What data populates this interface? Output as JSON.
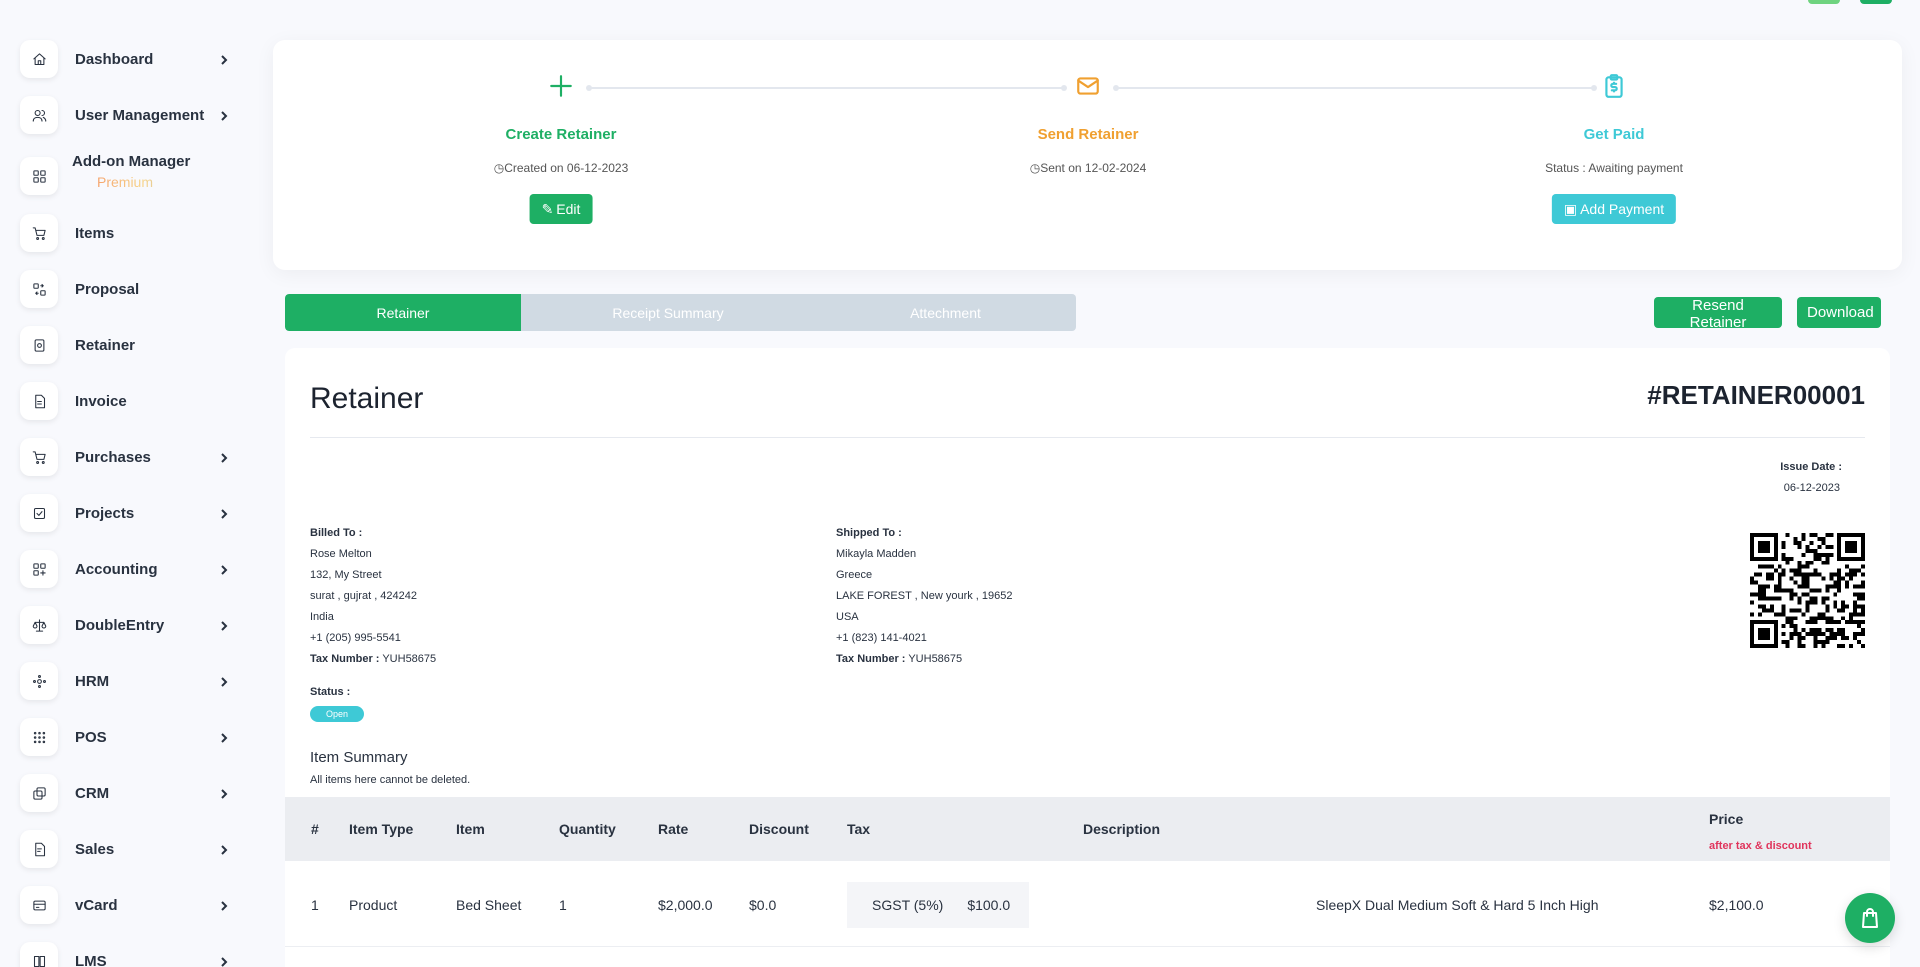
{
  "sidebar": {
    "items": [
      {
        "label": "Dashboard",
        "icon": "home-icon",
        "chevron": true
      },
      {
        "label": "User Management",
        "icon": "users-icon",
        "chevron": true
      },
      {
        "label": "Add-on Manager",
        "icon": "apps-icon",
        "chevron": false,
        "badge": "Premium"
      },
      {
        "label": "Items",
        "icon": "cart-icon",
        "chevron": false
      },
      {
        "label": "Proposal",
        "icon": "exchange-icon",
        "chevron": false
      },
      {
        "label": "Retainer",
        "icon": "retainer-icon",
        "chevron": false
      },
      {
        "label": "Invoice",
        "icon": "invoice-icon",
        "chevron": false
      },
      {
        "label": "Purchases",
        "icon": "purchase-cart-icon",
        "chevron": true
      },
      {
        "label": "Projects",
        "icon": "checkbox-icon",
        "chevron": true
      },
      {
        "label": "Accounting",
        "icon": "grid-plus-icon",
        "chevron": true
      },
      {
        "label": "DoubleEntry",
        "icon": "scale-icon",
        "chevron": true
      },
      {
        "label": "HRM",
        "icon": "hrm-icon",
        "chevron": true
      },
      {
        "label": "POS",
        "icon": "dots-grid-icon",
        "chevron": true
      },
      {
        "label": "CRM",
        "icon": "crm-icon",
        "chevron": true
      },
      {
        "label": "Sales",
        "icon": "sales-icon",
        "chevron": true
      },
      {
        "label": "vCard",
        "icon": "card-icon",
        "chevron": true
      },
      {
        "label": "LMS",
        "icon": "book-icon",
        "chevron": true
      }
    ]
  },
  "progress": {
    "create": {
      "title": "Create Retainer",
      "sub": "Created on 06-12-2023",
      "button": "Edit"
    },
    "send": {
      "title": "Send Retainer",
      "sub": "Sent on 12-02-2024"
    },
    "paid": {
      "title": "Get Paid",
      "sub": "Status : Awaiting payment",
      "button": "Add Payment"
    }
  },
  "tabs": [
    "Retainer",
    "Receipt Summary",
    "Attechment"
  ],
  "actions": {
    "resend": "Resend Retainer",
    "download": "Download"
  },
  "doc": {
    "title": "Retainer",
    "number": "#RETAINER00001",
    "issue_label": "Issue Date :",
    "issue_value": "06-12-2023",
    "billed": {
      "label": "Billed To :",
      "lines": [
        "Rose Melton",
        "132, My Street",
        "surat , gujrat , 424242",
        "India",
        "+1 (205) 995-5541"
      ],
      "tax_label": "Tax Number :",
      "tax_value": "YUH58675"
    },
    "shipped": {
      "label": "Shipped To :",
      "lines": [
        "Mikayla Madden",
        "Greece",
        "LAKE FOREST , New yourk , 19652",
        "USA",
        "+1 (823) 141-4021"
      ],
      "tax_label": "Tax Number :",
      "tax_value": "YUH58675"
    },
    "status_label": "Status :",
    "status_value": "Open",
    "summary_title": "Item Summary",
    "summary_note": "All items here cannot be deleted."
  },
  "table": {
    "headers": {
      "num": "#",
      "type": "Item Type",
      "item": "Item",
      "qty": "Quantity",
      "rate": "Rate",
      "discount": "Discount",
      "tax": "Tax",
      "desc": "Description",
      "price": "Price",
      "price_sub": "after tax & discount"
    },
    "rows": [
      {
        "num": "1",
        "type": "Product",
        "item": "Bed Sheet",
        "qty": "1",
        "rate": "$2,000.0",
        "discount": "$0.0",
        "tax_name": "SGST (5%)",
        "tax_amount": "$100.0",
        "desc": "SleepX Dual Medium Soft & Hard 5 Inch High",
        "price": "$2,100.0"
      }
    ]
  },
  "colors": {
    "green": "#1eaf64",
    "orange": "#f0a030",
    "teal": "#3ec9d6",
    "pink": "#e0345c"
  }
}
